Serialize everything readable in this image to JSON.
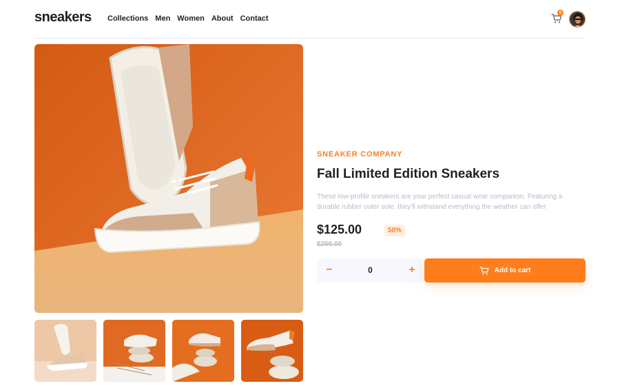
{
  "header": {
    "logo": "sneakers",
    "nav": [
      "Collections",
      "Men",
      "Women",
      "About",
      "Contact"
    ],
    "cart_count": "0",
    "icons": {
      "cart": "cart-icon",
      "avatar": "user-avatar"
    }
  },
  "gallery": {
    "thumbnails": 4,
    "active": 1
  },
  "product": {
    "company": "Sneaker Company",
    "title": "Fall Limited Edition Sneakers",
    "description": "These low-profile sneakers are your perfect casual wear companion. Featuring a durable rubber outer sole, they'll withstand everything the weather can offer",
    "price": "$125.00",
    "discount": "50%",
    "original_price": "$250.00"
  },
  "cart_controls": {
    "minus": "−",
    "quantity": "0",
    "plus": "+",
    "add_label": "Add to cart"
  },
  "colors": {
    "accent": "#ff7e1b",
    "accent_pale": "#ffede0",
    "text_dark": "#1d2026",
    "text_muted": "#b6bcc8",
    "light_bg": "#f6f8fd"
  }
}
